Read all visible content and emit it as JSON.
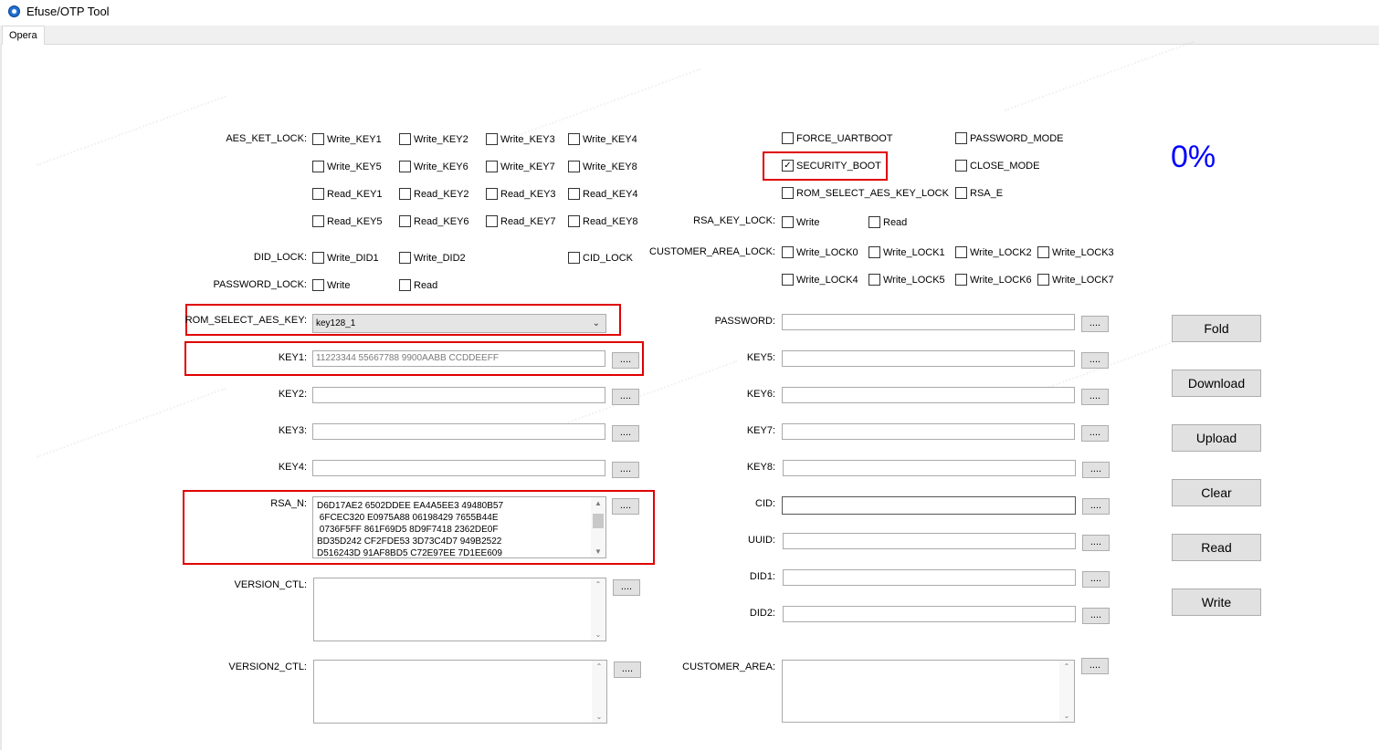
{
  "window": {
    "title": "Efuse/OTP Tool",
    "icon": "app-disc-icon"
  },
  "tabs": [
    {
      "label": "Opera",
      "selected": true
    }
  ],
  "progress": {
    "text": "0%",
    "value": 0,
    "color": "#0000ff"
  },
  "aes_key_lock": {
    "label": "AES_KET_LOCK:",
    "rows": [
      [
        "Write_KEY1",
        "Write_KEY2",
        "Write_KEY3",
        "Write_KEY4"
      ],
      [
        "Write_KEY5",
        "Write_KEY6",
        "Write_KEY7",
        "Write_KEY8"
      ],
      [
        "Read_KEY1",
        "Read_KEY2",
        "Read_KEY3",
        "Read_KEY4"
      ],
      [
        "Read_KEY5",
        "Read_KEY6",
        "Read_KEY7",
        "Read_KEY8"
      ]
    ]
  },
  "did_lock": {
    "label": "DID_LOCK:",
    "options": [
      "Write_DID1",
      "Write_DID2"
    ],
    "cid_lock": "CID_LOCK"
  },
  "password_lock": {
    "label": "PASSWORD_LOCK:",
    "options": [
      "Write",
      "Read"
    ]
  },
  "flags": {
    "force_uartboot": "FORCE_UARTBOOT",
    "password_mode": "PASSWORD_MODE",
    "security_boot": "SECURITY_BOOT",
    "security_boot_checked": true,
    "close_mode": "CLOSE_MODE",
    "rom_select_aes_key_lock": "ROM_SELECT_AES_KEY_LOCK",
    "rsa_e": "RSA_E"
  },
  "rsa_key_lock": {
    "label": "RSA_KEY_LOCK:",
    "options": [
      "Write",
      "Read"
    ]
  },
  "customer_area_lock": {
    "label": "CUSTOMER_AREA_LOCK:",
    "rows": [
      [
        "Write_LOCK0",
        "Write_LOCK1",
        "Write_LOCK2",
        "Write_LOCK3"
      ],
      [
        "Write_LOCK4",
        "Write_LOCK5",
        "Write_LOCK6",
        "Write_LOCK7"
      ]
    ]
  },
  "rom_select_aes_key": {
    "label": "ROM_SELECT_AES_KEY:",
    "value": "key128_1"
  },
  "left_fields": {
    "key1": {
      "label": "KEY1:",
      "value": "11223344 55667788 9900AABB CCDDEEFF"
    },
    "key2": {
      "label": "KEY2:",
      "value": ""
    },
    "key3": {
      "label": "KEY3:",
      "value": ""
    },
    "key4": {
      "label": "KEY4:",
      "value": ""
    },
    "rsa_n": {
      "label": "RSA_N:",
      "lines": [
        "D6D17AE2 6502DDEE EA4A5EE3 49480B57",
        " 6FCEC320 E0975A88 06198429 7655B44E",
        " 0736F5FF 861F69D5 8D9F7418 2362DE0F",
        "BD35D242 CF2FDE53 3D73C4D7 949B2522",
        "D516243D 91AF8BD5 C72E97EE 7D1EE609"
      ]
    },
    "version_ctl": {
      "label": "VERSION_CTL:"
    },
    "version2_ctl": {
      "label": "VERSION2_CTL:"
    }
  },
  "right_fields": {
    "password": {
      "label": "PASSWORD:"
    },
    "key5": {
      "label": "KEY5:"
    },
    "key6": {
      "label": "KEY6:"
    },
    "key7": {
      "label": "KEY7:"
    },
    "key8": {
      "label": "KEY8:"
    },
    "cid": {
      "label": "CID:"
    },
    "uuid": {
      "label": "UUID:"
    },
    "did1": {
      "label": "DID1:"
    },
    "did2": {
      "label": "DID2:"
    },
    "customer_area": {
      "label": "CUSTOMER_AREA:"
    }
  },
  "browse_label": "....",
  "actions": [
    "Fold",
    "Download",
    "Upload",
    "Clear",
    "Read",
    "Write"
  ],
  "accent_colors": {
    "highlight_box": "#e00000",
    "progress": "#0000ff"
  }
}
